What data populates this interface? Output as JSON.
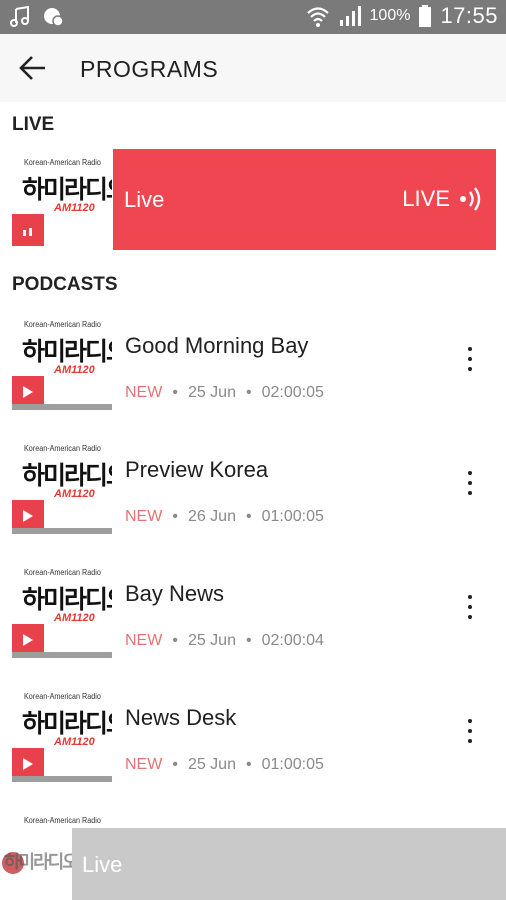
{
  "status_bar": {
    "battery": "100%",
    "time": "17:55",
    "icons": [
      "music-icon",
      "chat-icon",
      "wifi-icon",
      "signal-icon",
      "battery-icon"
    ]
  },
  "app_bar": {
    "title": "PROGRAMS"
  },
  "live_section": {
    "title": "LIVE",
    "card": {
      "label": "Live",
      "badge": "LIVE"
    }
  },
  "thumbnail": {
    "line1": "Korean-American Radio",
    "line2": "하미라디오",
    "line3": "AM1120"
  },
  "podcasts_section": {
    "title": "PODCASTS",
    "items": [
      {
        "title": "Good Morning Bay",
        "new": "NEW",
        "date": "25 Jun",
        "duration": "02:00:05"
      },
      {
        "title": "Preview Korea",
        "new": "NEW",
        "date": "26 Jun",
        "duration": "01:00:05"
      },
      {
        "title": "Bay News",
        "new": "NEW",
        "date": "25 Jun",
        "duration": "02:00:04"
      },
      {
        "title": "News Desk",
        "new": "NEW",
        "date": "25 Jun",
        "duration": "01:00:05"
      }
    ],
    "separator": "•"
  },
  "player": {
    "label": "Live"
  },
  "colors": {
    "accent": "#f04651",
    "status_bar": "#7a7a7a",
    "player_bar": "#c9c9c9"
  }
}
